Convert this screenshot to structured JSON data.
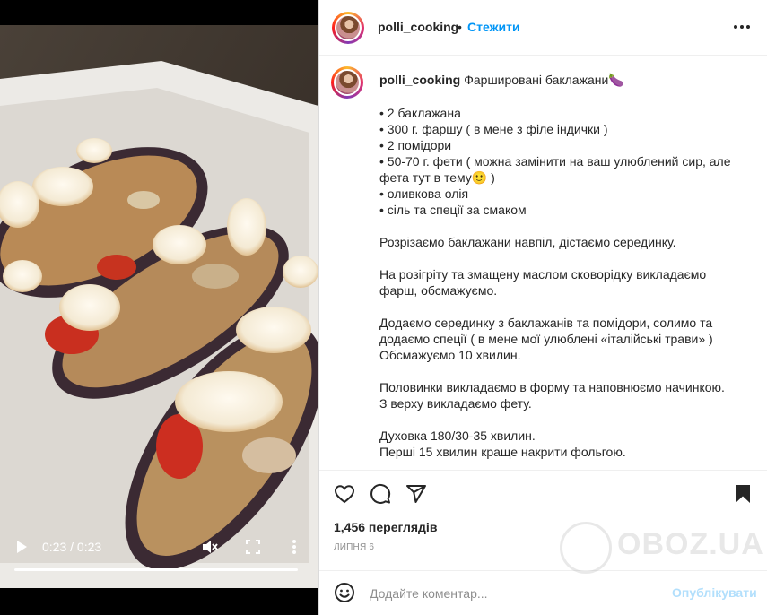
{
  "video": {
    "time": "0:23 / 0:23",
    "progress": 1.0
  },
  "header": {
    "username": "polli_cooking",
    "separator": "•",
    "follow_label": "Стежити"
  },
  "caption": {
    "username": "polli_cooking",
    "title": "Фаршировані баклажани🍆",
    "lines": [
      "• 2 баклажана",
      "• 300 г. фаршу ( в мене з філе індички )",
      "• 2 помідори",
      "• 50-70 г. фети ( можна замінити на ваш улюблений сир, але фета тут в тему🙂 )",
      "• оливкова олія",
      "• сіль та спеції за смаком",
      "",
      "Розрізаємо баклажани навпіл, дістаємо серединку.",
      "",
      "На розігріту та змащену маслом сковорідку викладаємо фарш, обсмажуємо.",
      "",
      "Додаємо серединку з баклажанів та помідори, солимо та додаємо спеції ( в мене мої улюблені «італійські трави» )",
      "Обсмажуємо 10 хвилин.",
      "",
      "Половинки викладаємо в форму та наповнюємо начинкою.",
      "З верху викладаємо фету.",
      "",
      "Духовка 180/30-35 хвилин.",
      "Перші 15 хвилин краще накрити фольгою."
    ]
  },
  "stats": {
    "views": "1,456 переглядів",
    "date": "ЛИПНЯ 6"
  },
  "comment": {
    "placeholder": "Додайте коментар...",
    "publish_label": "Опублікувати"
  },
  "watermark": {
    "text": "OBOZ.UA"
  },
  "colors": {
    "accent": "#0095f6",
    "publish_disabled": "#b2dffc",
    "text": "#262626",
    "muted": "#8e8e8e"
  }
}
